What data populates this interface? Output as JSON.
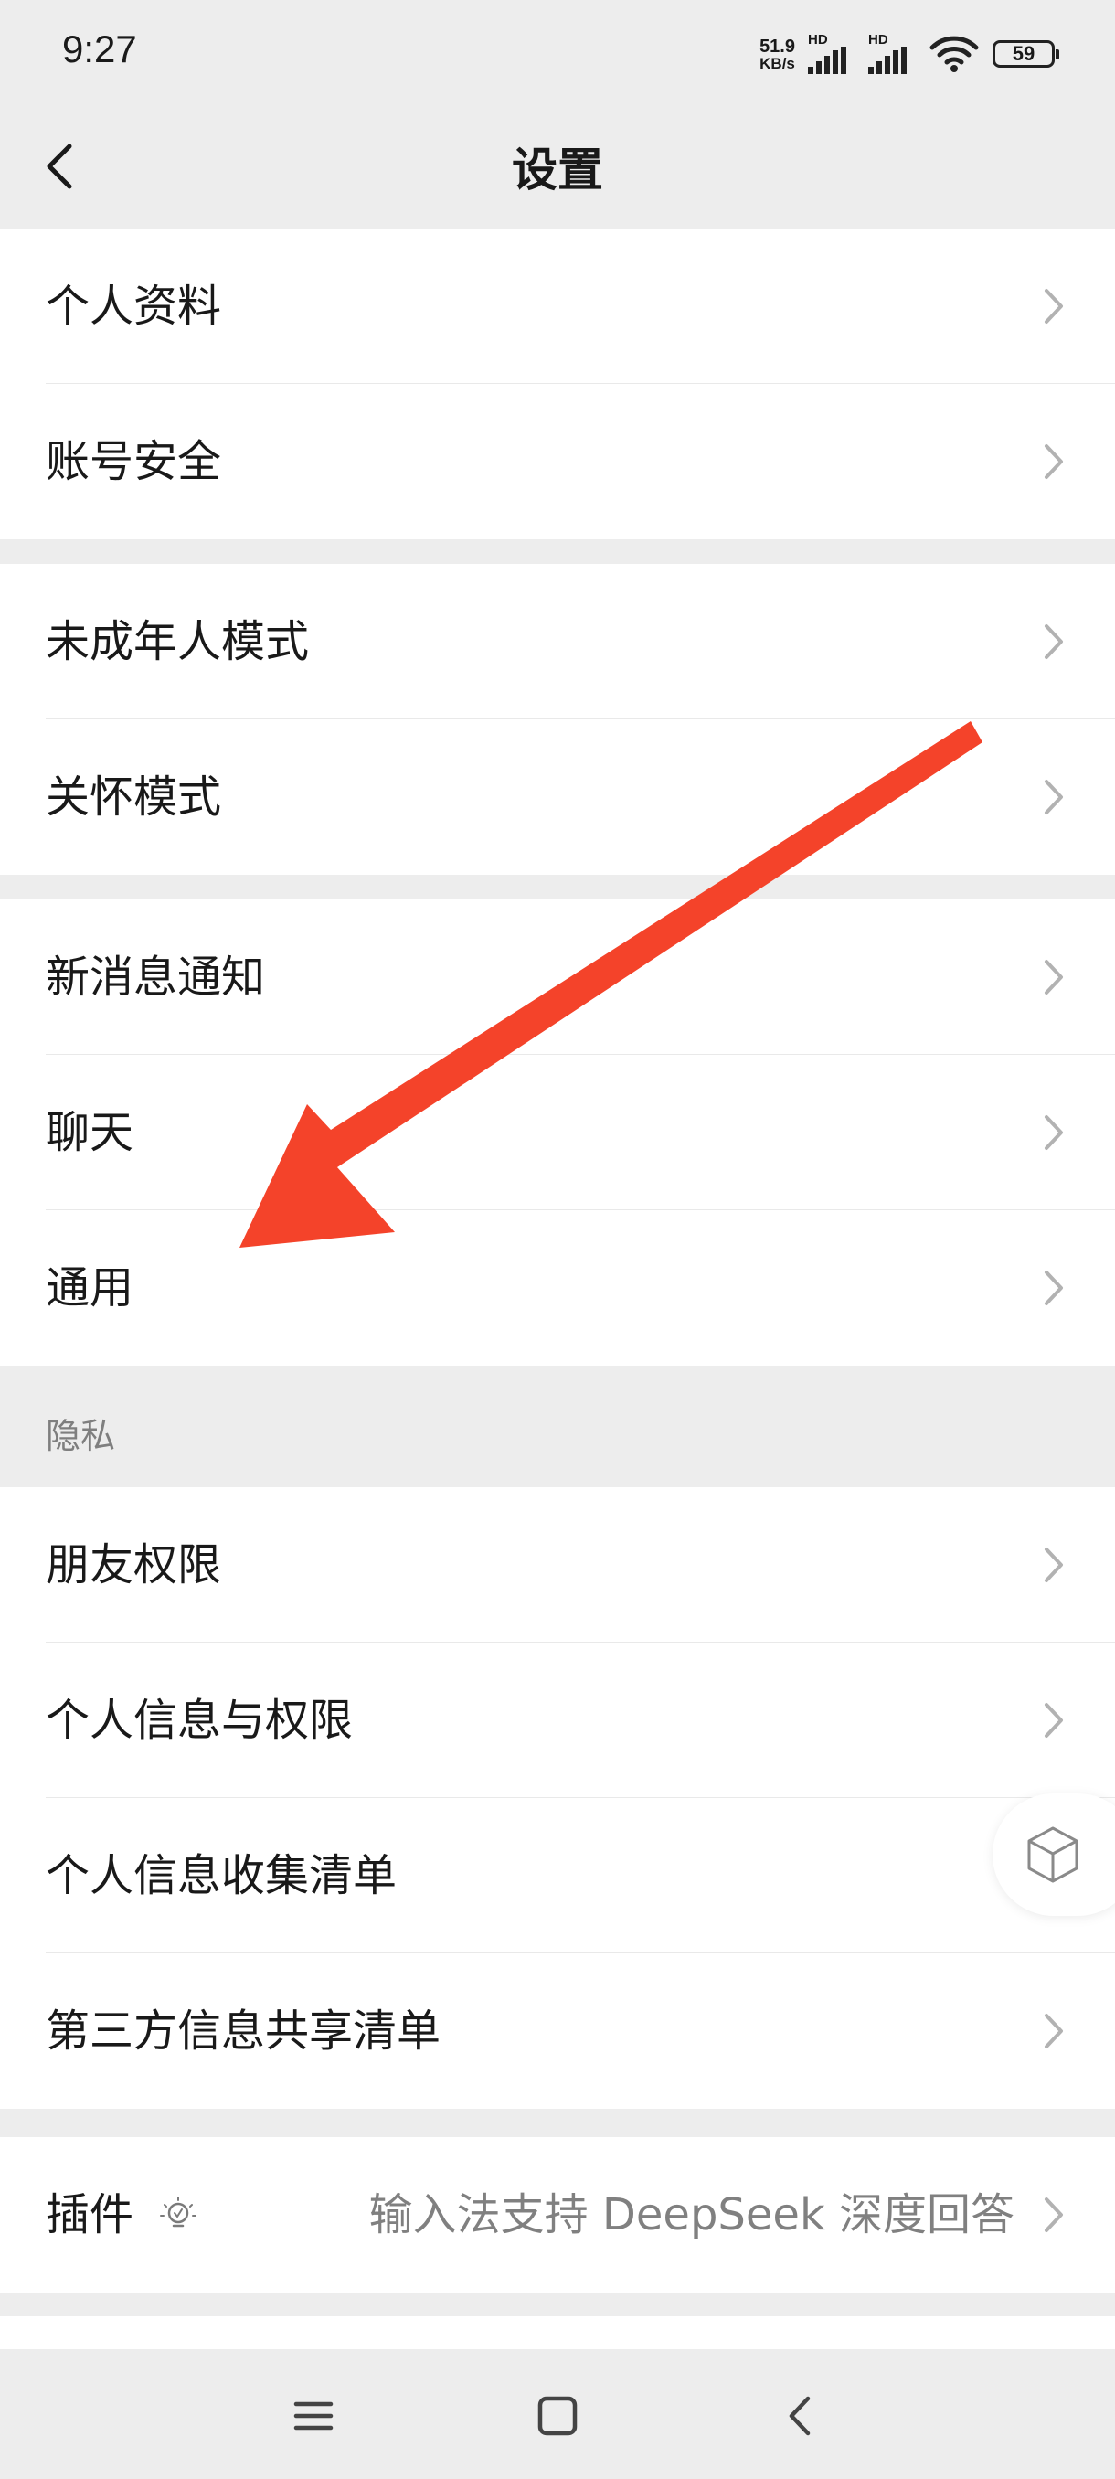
{
  "status_bar": {
    "time": "9:27",
    "net_speed_value": "51.9",
    "net_speed_unit": "KB/s",
    "sim1_label": "HD",
    "sim2_label": "HD",
    "battery": "59"
  },
  "header": {
    "title": "设置"
  },
  "groups": [
    {
      "items": [
        {
          "label": "个人资料"
        },
        {
          "label": "账号安全"
        }
      ]
    },
    {
      "items": [
        {
          "label": "未成年人模式"
        },
        {
          "label": "关怀模式"
        }
      ]
    },
    {
      "items": [
        {
          "label": "新消息通知"
        },
        {
          "label": "聊天"
        },
        {
          "label": "通用"
        }
      ]
    },
    {
      "section_title": "隐私",
      "items": [
        {
          "label": "朋友权限"
        },
        {
          "label": "个人信息与权限"
        },
        {
          "label": "个人信息收集清单"
        },
        {
          "label": "第三方信息共享清单"
        }
      ]
    },
    {
      "items": [
        {
          "label": "插件",
          "extra": "输入法支持 DeepSeek 深度回答"
        }
      ]
    }
  ],
  "annotation": {
    "color": "#f4432a"
  },
  "colors": {
    "background": "#ededed",
    "cell": "#ffffff",
    "text": "#191919",
    "secondary": "#808080"
  }
}
